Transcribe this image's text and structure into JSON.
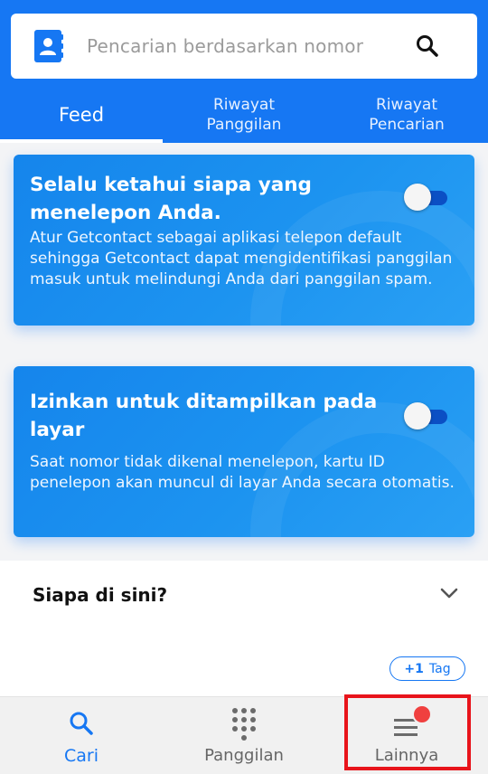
{
  "search": {
    "placeholder": "Pencarian berdasarkan nomor",
    "icon": "search-icon"
  },
  "tabs": [
    {
      "label": "Feed",
      "active": true
    },
    {
      "line1": "Riwayat",
      "line2": "Panggilan"
    },
    {
      "line1": "Riwayat",
      "line2": "Pencarian"
    }
  ],
  "cards": [
    {
      "title": "Selalu ketahui siapa yang menelepon Anda.",
      "description": "Atur Getcontact sebagai aplikasi telepon default sehingga Getcontact dapat mengidentifikasi panggilan masuk untuk melindungi Anda dari panggilan spam.",
      "toggle_on": false
    },
    {
      "title": "Izinkan untuk ditampilkan pada layar",
      "description": "Saat nomor tidak dikenal menelepon, kartu ID penelepon akan muncul di layar Anda secara otomatis.",
      "toggle_on": false
    }
  ],
  "who_here": {
    "title": "Siapa di sini?"
  },
  "tag_button": {
    "count": "+1",
    "label": "Tag"
  },
  "bottom_nav": [
    {
      "label": "Cari",
      "icon": "search-icon",
      "active": true
    },
    {
      "label": "Panggilan",
      "icon": "dialpad-icon",
      "active": false
    },
    {
      "label": "Lainnya",
      "icon": "menu-icon",
      "active": false,
      "has_notification": true
    }
  ],
  "colors": {
    "primary": "#1677f3",
    "highlight": "#e8141b",
    "badge": "#f0403f"
  }
}
